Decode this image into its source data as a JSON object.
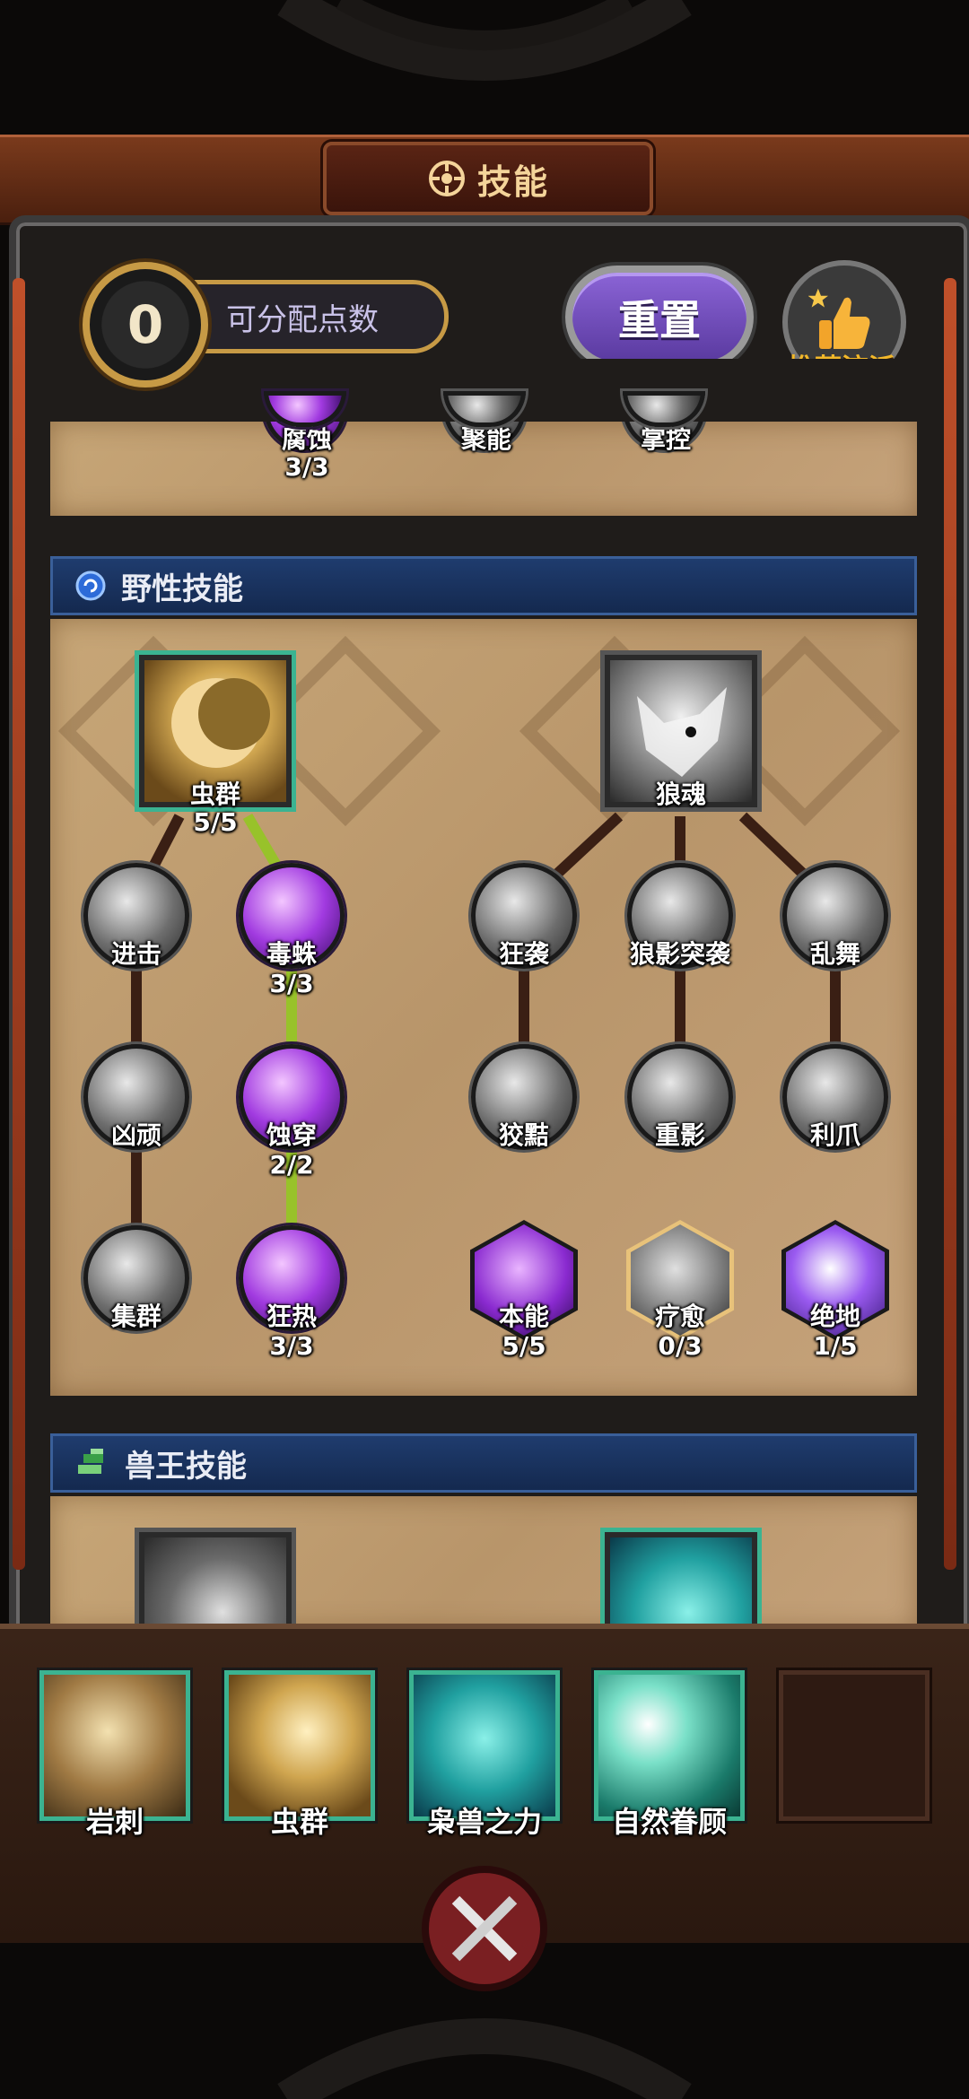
{
  "header": {
    "title": "技能",
    "title_icon": "gear-emblem-icon"
  },
  "top": {
    "points_value": "0",
    "points_label": "可分配点数",
    "reset_label": "重置",
    "recommend_label": "推荐流派",
    "recommend_icon": "thumbs-up-icon"
  },
  "prev_section": {
    "nodes": [
      {
        "label": "腐蚀",
        "level": "3/3"
      },
      {
        "label": "聚能",
        "level": ""
      },
      {
        "label": "掌控",
        "level": ""
      }
    ]
  },
  "wild_section": {
    "title": "野性技能",
    "root_left": {
      "label": "虫群",
      "level": "5/5"
    },
    "root_right": {
      "label": "狼魂",
      "level": ""
    },
    "row1": [
      {
        "label": "进击"
      },
      {
        "label": "毒蛛",
        "level": "3/3"
      },
      {
        "label": "狂袭"
      },
      {
        "label": "狼影突袭"
      },
      {
        "label": "乱舞"
      }
    ],
    "row2": [
      {
        "label": "凶顽"
      },
      {
        "label": "蚀穿",
        "level": "2/2"
      },
      {
        "label": "狡黠"
      },
      {
        "label": "重影"
      },
      {
        "label": "利爪"
      }
    ],
    "row3": [
      {
        "label": "集群"
      },
      {
        "label": "狂热",
        "level": "3/3"
      },
      {
        "label": "本能",
        "level": "5/5"
      },
      {
        "label": "疗愈",
        "level": "0/3"
      },
      {
        "label": "绝地",
        "level": "1/5"
      }
    ]
  },
  "beast_section": {
    "title": "兽王技能"
  },
  "equipped": [
    {
      "label": "岩刺"
    },
    {
      "label": "虫群"
    },
    {
      "label": "枭兽之力"
    },
    {
      "label": "自然眷顾"
    },
    {
      "label": ""
    }
  ],
  "colors": {
    "accent_purple": "#7a52c8",
    "link_green": "#98c22a",
    "frame_teal": "#3bb391",
    "header_blue": "#1f3c6e"
  }
}
